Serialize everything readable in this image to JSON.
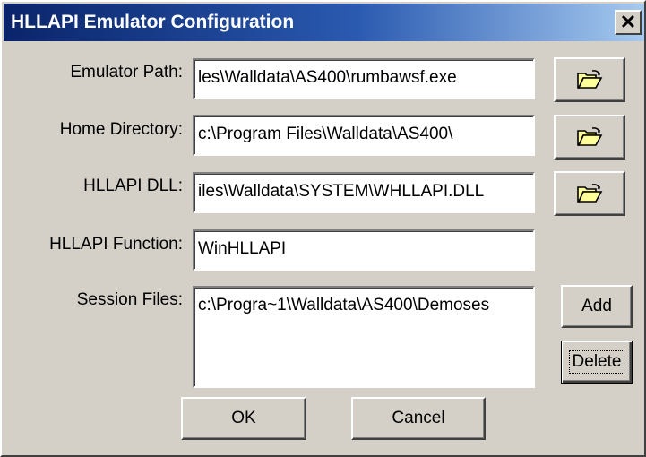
{
  "window": {
    "title": "HLLAPI Emulator Configuration",
    "close_glyph": "✕"
  },
  "fields": {
    "emulator_path": {
      "label": "Emulator Path:",
      "value": "les\\Walldata\\AS400\\rumbawsf.exe"
    },
    "home_directory": {
      "label": "Home Directory:",
      "value": "c:\\Program Files\\Walldata\\AS400\\"
    },
    "hllapi_dll": {
      "label": "HLLAPI DLL:",
      "value": "iles\\Walldata\\SYSTEM\\WHLLAPI.DLL"
    },
    "hllapi_function": {
      "label": "HLLAPI Function:",
      "value": "WinHLLAPI"
    },
    "session_files": {
      "label": "Session Files:",
      "items": [
        "c:\\Progra~1\\Walldata\\AS400\\Demoses"
      ]
    }
  },
  "buttons": {
    "add": "Add",
    "delete": "Delete",
    "ok": "OK",
    "cancel": "Cancel"
  },
  "icons": {
    "browse": "open-folder-icon"
  },
  "colors": {
    "titlebar": "#0a246a",
    "face": "#d4d0c8",
    "folder": "#ffff99"
  }
}
